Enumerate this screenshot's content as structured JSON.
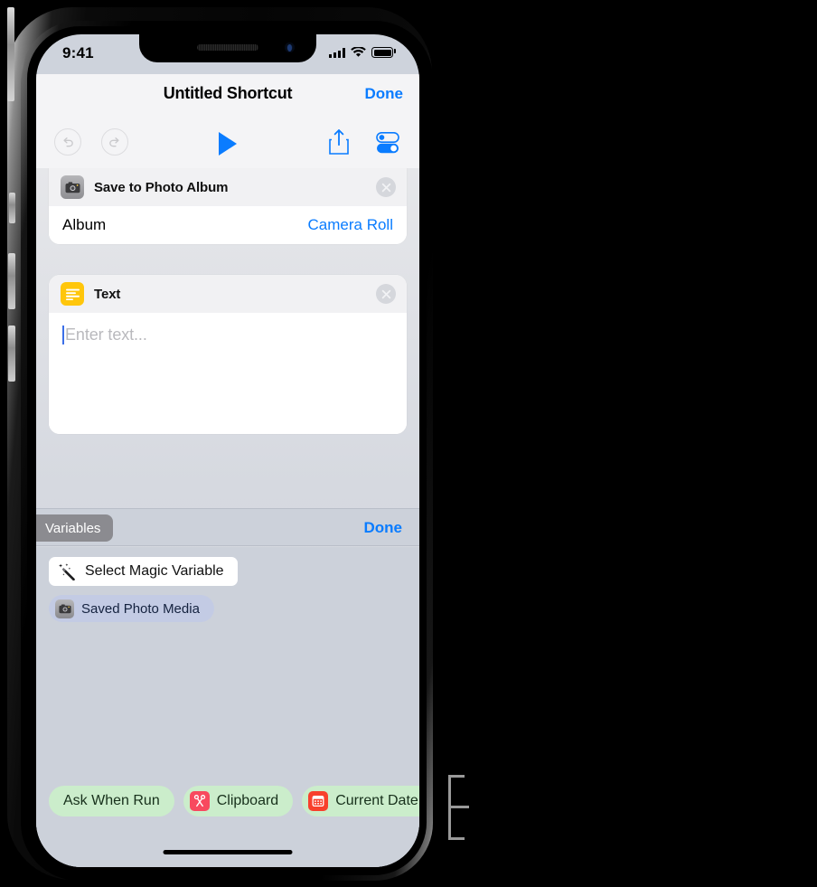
{
  "status_bar": {
    "time": "9:41",
    "signal_icon": "cellular-bars-icon",
    "wifi_icon": "wifi-icon",
    "battery_icon": "battery-full-icon"
  },
  "nav": {
    "title": "Untitled Shortcut",
    "done_label": "Done"
  },
  "toolbar": {
    "undo_icon": "undo-arrow-icon",
    "redo_icon": "redo-arrow-icon",
    "play_icon": "play-triangle-icon",
    "share_icon": "share-up-arrow-icon",
    "settings_icon": "toggles-settings-icon"
  },
  "actions": [
    {
      "icon_name": "camera-icon",
      "title": "Save to Photo Album",
      "close_icon": "close-circle-icon",
      "row": {
        "label": "Album",
        "value": "Camera Roll"
      }
    },
    {
      "icon_name": "text-lines-icon",
      "title": "Text",
      "close_icon": "close-circle-icon",
      "text_field": {
        "value": "",
        "placeholder": "Enter text..."
      }
    }
  ],
  "variables_bar": {
    "tab_label": "Variables",
    "done_label": "Done"
  },
  "variables_panel": {
    "magic_button": {
      "icon_name": "magic-wand-icon",
      "label": "Select Magic Variable"
    },
    "magic_variables": [
      {
        "icon_name": "camera-icon",
        "label": "Saved Photo Media"
      }
    ],
    "bottom_chips": [
      {
        "icon_name": "",
        "label": "Ask When Run"
      },
      {
        "icon_name": "scissors-icon",
        "label": "Clipboard"
      },
      {
        "icon_name": "calendar-icon",
        "label": "Current Date"
      }
    ]
  },
  "colors": {
    "accent_blue": "#0a7cff",
    "text_icon_yellow": "#ffc60b",
    "clipboard_red": "#f8495e",
    "calendar_red": "#f8402c",
    "chip_green": "#cbedcb",
    "magic_chip_blue": "#c3cbe4",
    "panel_gray": "#ccd1da",
    "variables_tab_gray": "#8b8b90"
  }
}
